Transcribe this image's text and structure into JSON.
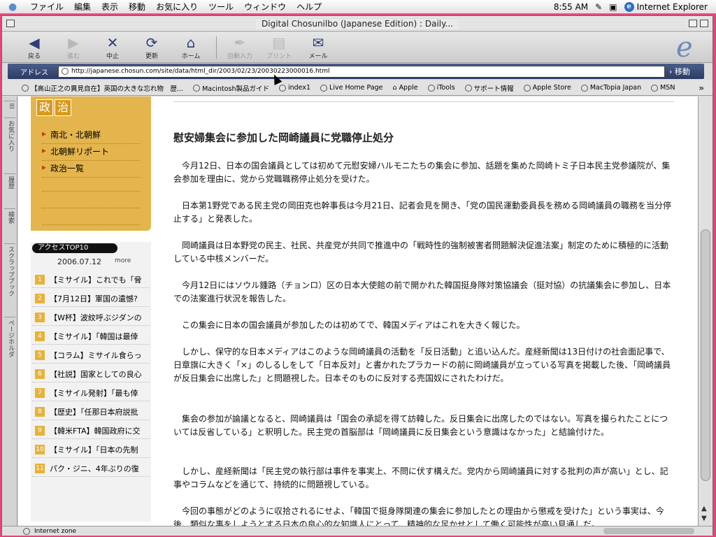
{
  "menubar": {
    "items": [
      "ファイル",
      "編集",
      "表示",
      "移動",
      "お気に入り",
      "ツール",
      "ウィンドウ",
      "ヘルプ"
    ],
    "clock": "8:55 AM",
    "app_name": "Internet Explorer"
  },
  "window": {
    "title": "Digital Chosunilbo (Japanese Edition) : Daily..."
  },
  "toolbar": {
    "back": "戻る",
    "forward": "進む",
    "stop": "中止",
    "refresh": "更新",
    "home": "ホーム",
    "autofill": "自動入力",
    "print": "プリント",
    "mail": "メール"
  },
  "address": {
    "label": "アドレス",
    "url": "http://japanese.chosun.com/site/data/html_dir/2003/02/23/20030223000016.html",
    "go_label": "移動"
  },
  "favorites": [
    "【高山正之の異見自在】英国の大きな忘れ物　歴...",
    "Macintosh製品ガイド",
    "index1",
    "Live Home Page",
    "Apple",
    "iTools",
    "サポート情報",
    "Apple Store",
    "MacTopia Japan",
    "MSN"
  ],
  "sidetabs": [
    "お気に入り",
    "履歴",
    "検索",
    "スクラップブック",
    "ページホルダ"
  ],
  "left_nav": {
    "section": [
      "政",
      "治"
    ],
    "items": [
      "南北・北朝鮮",
      "北朝鮮リポート",
      "政治一覧"
    ]
  },
  "access": {
    "title": "アクセスTOP10",
    "date": "2006.07.12",
    "more": "more",
    "items": [
      {
        "num": "1",
        "text": "【ミサイル】これでも「脅"
      },
      {
        "num": "2",
        "text": "【7月12日】軍国の遺憾?"
      },
      {
        "num": "3",
        "text": "【W杯】波紋呼ぶジダンの"
      },
      {
        "num": "4",
        "text": "【ミサイル】「韓国は最倖"
      },
      {
        "num": "5",
        "text": "【コラム】ミサイル食らっ"
      },
      {
        "num": "6",
        "text": "【社説】国家としての良心"
      },
      {
        "num": "7",
        "text": "【ミサイル発射】「最も倖"
      },
      {
        "num": "8",
        "text": "【歴史】「任那日本府説批"
      },
      {
        "num": "9",
        "text": "【韓米FTA】韓国政府に交"
      },
      {
        "num": "10",
        "text": "【ミサイル】「日本の先制"
      },
      {
        "num": "11",
        "text": "パク・ジニ、4年ぶりの復"
      }
    ]
  },
  "article": {
    "title": "慰安婦集会に参加した岡崎議員に党職停止処分",
    "paragraphs": [
      "今月12日、日本の国会議員としては初めて元慰安婦ハルモニたちの集会に参加、話題を集めた岡崎トミ子日本民主党参議院が、集会参加を理由に、党から党職職務停止処分を受けた。",
      "日本第1野党である民主党の岡田克也幹事長は今月21日、記者会見を開き、「党の国民運動委員長を務める岡崎議員の職務を当分停止する」と発表した。",
      "岡崎議員は日本野党の民主、社民、共産党が共同で推進中の「戦時性的強制被害者問題解決促進法案」制定のために積極的に活動している中核メンバーだ。",
      "今月12日にはソウル鍾路（チョンロ）区の日本大使館の前で開かれた韓国挺身隊対策協議会（挺対協）の抗議集会に参加し、日本での法案進行状況を報告した。",
      "この集会に日本の国会議員が参加したのは初めてで、韓国メディアはこれを大きく報じた。",
      "しかし、保守的な日本メディアはこのような岡崎議員の活動を「反日活動」と追い込んだ。産経新聞は13日付けの社会面記事で、日章旗に大きく「×」のしるしをして「日本反対」と書かれたプラカードの前に岡崎議員が立っている写真を掲載した後、「岡崎議員が反日集会に出席した」と問題視した。日本そのものに反対する売国奴にされたわけだ。",
      "集会の参加が論議となると、岡崎議員は「国会の承認を得て訪韓した。反日集会に出席したのではない。写真を撮られたことについては反省している」と釈明した。民主党の首脳部は「岡崎議員に反日集会という意識はなかった」と結論付けた。",
      "しかし、産経新聞は「民主党の執行部は事件を事実上、不問に伏す構えだ。党内から岡崎議員に対する批判の声が高い」とし、記事やコラムなどを通じて、持続的に問題視している。",
      "今回の事態がどのように収拾されるにせよ、「韓国で挺身隊関連の集会に参加したとの理由から懲戒を受けた」という事実は、今後、類似な事をしようとする日本の良心的な知識人にとって、精神的な足かせとして働く可能性が高い見通しだ。"
    ]
  },
  "status": {
    "zone": "Internet zone"
  }
}
